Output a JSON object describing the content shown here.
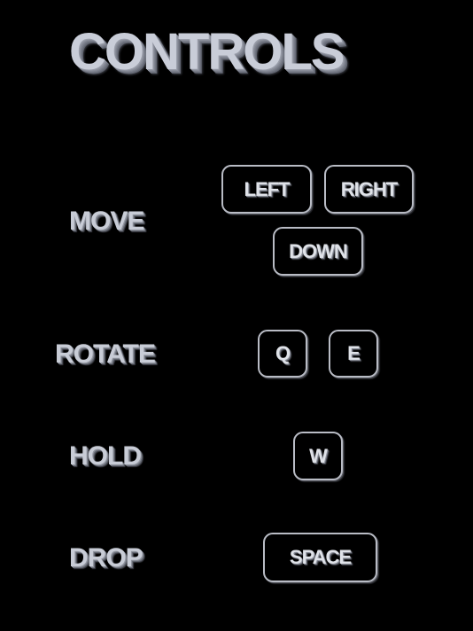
{
  "title": "CONTROLS",
  "rows": {
    "move": {
      "label": "MOVE",
      "keys": [
        "LEFT",
        "RIGHT",
        "DOWN"
      ]
    },
    "rotate": {
      "label": "ROTATE",
      "keys": [
        "Q",
        "E"
      ]
    },
    "hold": {
      "label": "HOLD",
      "keys": [
        "W"
      ]
    },
    "drop": {
      "label": "DROP",
      "keys": [
        "SPACE"
      ]
    }
  },
  "colors": {
    "background": "#000000",
    "text": "#c8ccd6",
    "key_border": "#b9bcc5"
  }
}
